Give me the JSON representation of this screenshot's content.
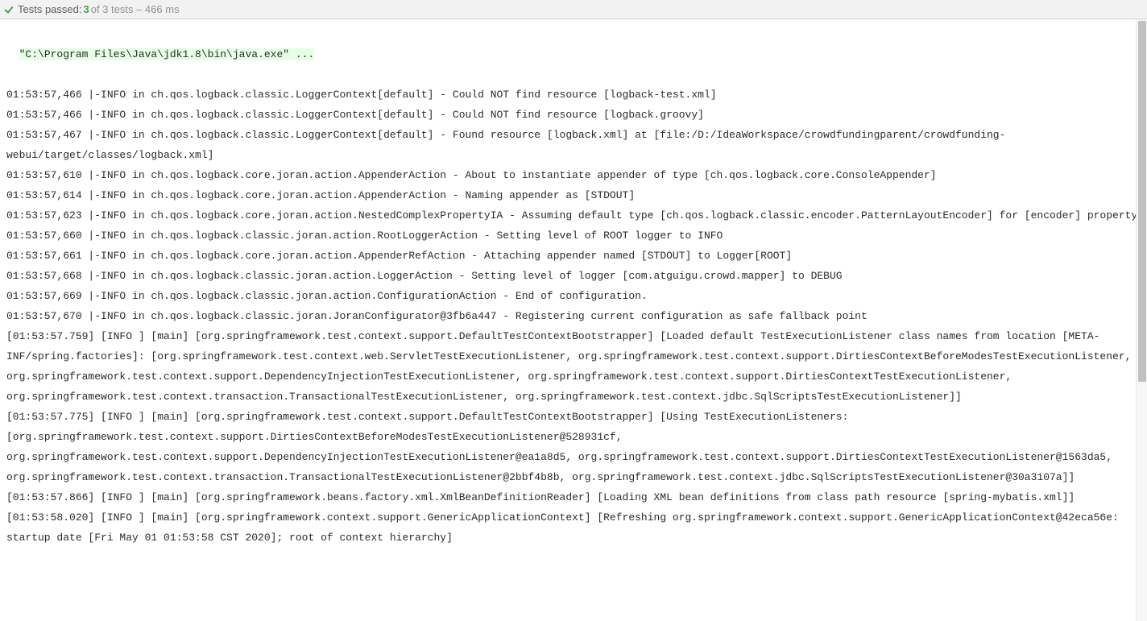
{
  "header": {
    "label": "Tests passed:",
    "passed_count": "3",
    "detail": "of 3 tests – 466 ms"
  },
  "console": {
    "command": "\"C:\\Program Files\\Java\\jdk1.8\\bin\\java.exe\" ...",
    "lines": [
      "01:53:57,466 |-INFO in ch.qos.logback.classic.LoggerContext[default] - Could NOT find resource [logback-test.xml]",
      "01:53:57,466 |-INFO in ch.qos.logback.classic.LoggerContext[default] - Could NOT find resource [logback.groovy]",
      "01:53:57,467 |-INFO in ch.qos.logback.classic.LoggerContext[default] - Found resource [logback.xml] at [file:/D:/IdeaWorkspace/crowdfundingparent/crowdfunding-webui/target/classes/logback.xml]",
      "01:53:57,610 |-INFO in ch.qos.logback.core.joran.action.AppenderAction - About to instantiate appender of type [ch.qos.logback.core.ConsoleAppender]",
      "01:53:57,614 |-INFO in ch.qos.logback.core.joran.action.AppenderAction - Naming appender as [STDOUT]",
      "01:53:57,623 |-INFO in ch.qos.logback.core.joran.action.NestedComplexPropertyIA - Assuming default type [ch.qos.logback.classic.encoder.PatternLayoutEncoder] for [encoder] property",
      "01:53:57,660 |-INFO in ch.qos.logback.classic.joran.action.RootLoggerAction - Setting level of ROOT logger to INFO",
      "01:53:57,661 |-INFO in ch.qos.logback.core.joran.action.AppenderRefAction - Attaching appender named [STDOUT] to Logger[ROOT]",
      "01:53:57,668 |-INFO in ch.qos.logback.classic.joran.action.LoggerAction - Setting level of logger [com.atguigu.crowd.mapper] to DEBUG",
      "01:53:57,669 |-INFO in ch.qos.logback.classic.joran.action.ConfigurationAction - End of configuration.",
      "01:53:57,670 |-INFO in ch.qos.logback.classic.joran.JoranConfigurator@3fb6a447 - Registering current configuration as safe fallback point",
      "[01:53:57.759] [INFO ] [main] [org.springframework.test.context.support.DefaultTestContextBootstrapper] [Loaded default TestExecutionListener class names from location [META-INF/spring.factories]: [org.springframework.test.context.web.ServletTestExecutionListener, org.springframework.test.context.support.DirtiesContextBeforeModesTestExecutionListener, org.springframework.test.context.support.DependencyInjectionTestExecutionListener, org.springframework.test.context.support.DirtiesContextTestExecutionListener, org.springframework.test.context.transaction.TransactionalTestExecutionListener, org.springframework.test.context.jdbc.SqlScriptsTestExecutionListener]]",
      "[01:53:57.775] [INFO ] [main] [org.springframework.test.context.support.DefaultTestContextBootstrapper] [Using TestExecutionListeners: [org.springframework.test.context.support.DirtiesContextBeforeModesTestExecutionListener@528931cf, org.springframework.test.context.support.DependencyInjectionTestExecutionListener@ea1a8d5, org.springframework.test.context.support.DirtiesContextTestExecutionListener@1563da5, org.springframework.test.context.transaction.TransactionalTestExecutionListener@2bbf4b8b, org.springframework.test.context.jdbc.SqlScriptsTestExecutionListener@30a3107a]]",
      "[01:53:57.866] [INFO ] [main] [org.springframework.beans.factory.xml.XmlBeanDefinitionReader] [Loading XML bean definitions from class path resource [spring-mybatis.xml]]",
      "[01:53:58.020] [INFO ] [main] [org.springframework.context.support.GenericApplicationContext] [Refreshing org.springframework.context.support.GenericApplicationContext@42eca56e: startup date [Fri May 01 01:53:58 CST 2020]; root of context hierarchy]"
    ]
  }
}
